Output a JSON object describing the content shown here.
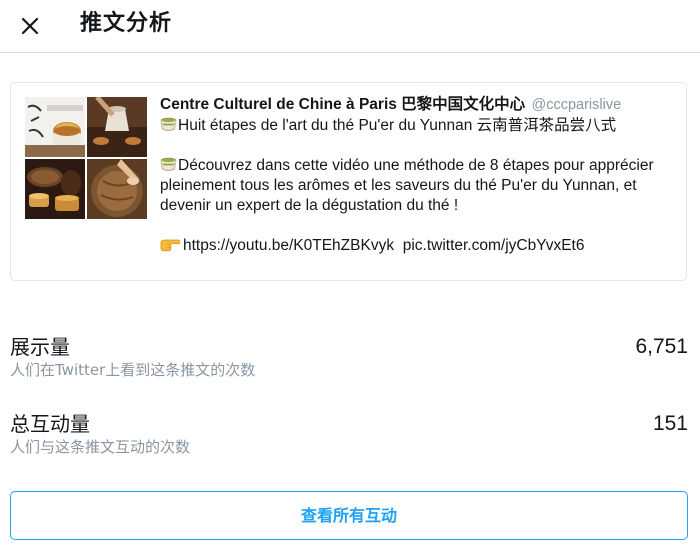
{
  "header": {
    "title": "推文分析",
    "close_icon": "close-icon"
  },
  "tweet": {
    "author_name": "Centre Culturel de Chine à Paris 巴黎中国文化中心",
    "author_handle": "@cccparislive",
    "line1": "Huit étapes de l'art du thé Pu'er du Yunnan 云南普洱茶品尝八式",
    "line2": "Découvrez dans cette vidéo une méthode de 8 étapes pour apprécier pleinement tous les arômes et les saveurs du thé Pu'er du Yunnan, et devenir un expert de la dégustation du thé !",
    "link_youtube": "https://youtu.be/K0TEhZBKvyk",
    "link_pic": "pic.twitter.com/jyCbYvxEt6",
    "icons": [
      "tea-emoji-icon",
      "tea-emoji-icon",
      "pointing-hand-emoji-icon"
    ]
  },
  "stats": {
    "impressions": {
      "label": "展示量",
      "description": "人们在Twitter上看到这条推文的次数",
      "value": "6,751"
    },
    "engagements": {
      "label": "总互动量",
      "description": "人们与这条推文互动的次数",
      "value": "151"
    }
  },
  "actions": {
    "view_all_label": "查看所有互动"
  },
  "colors": {
    "accent": "#1da1f2",
    "secondary_text": "#8a96a3",
    "border": "#e1e8ed"
  }
}
